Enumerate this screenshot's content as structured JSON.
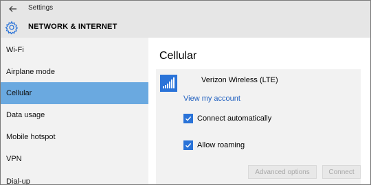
{
  "window": {
    "title": "Settings",
    "header_title": "NETWORK & INTERNET"
  },
  "sidebar": {
    "items": [
      {
        "label": "Wi-Fi"
      },
      {
        "label": "Airplane mode"
      },
      {
        "label": "Cellular",
        "selected": true
      },
      {
        "label": "Data usage"
      },
      {
        "label": "Mobile hotspot"
      },
      {
        "label": "VPN"
      },
      {
        "label": "Dial-up"
      }
    ]
  },
  "main": {
    "title": "Cellular",
    "carrier": "Verizon Wireless (LTE)",
    "view_account": "View my account",
    "options": [
      {
        "label": "Connect automatically",
        "checked": true
      },
      {
        "label": "Allow roaming",
        "checked": true
      }
    ],
    "buttons": {
      "advanced": "Advanced options",
      "connect": "Connect"
    }
  },
  "colors": {
    "accent": "#2a73d8",
    "selection": "#6aa9e0",
    "link": "#1f5fbf"
  },
  "icons": {
    "back": "back-arrow-icon",
    "settings": "gear-icon",
    "signal": "cellular-signal-icon",
    "check": "checkmark-icon"
  }
}
